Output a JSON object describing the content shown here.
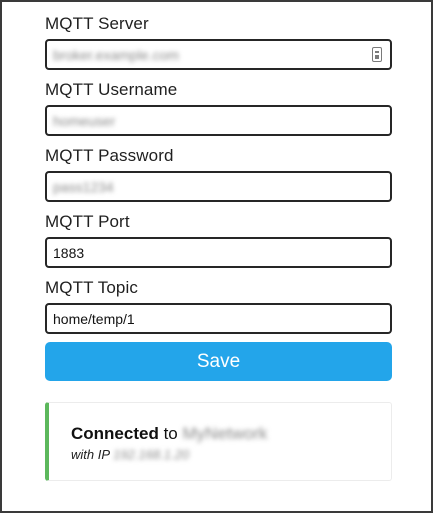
{
  "form": {
    "server": {
      "label": "MQTT Server",
      "value": "broker.example.com"
    },
    "username": {
      "label": "MQTT Username",
      "value": "homeuser"
    },
    "password": {
      "label": "MQTT Password",
      "value": "pass1234"
    },
    "port": {
      "label": "MQTT Port",
      "value": "1883"
    },
    "topic": {
      "label": "MQTT Topic",
      "value": "home/temp/1"
    }
  },
  "save_label": "Save",
  "status": {
    "connected_word": "Connected",
    "to_word": "to",
    "network_name": "MyNetwork",
    "ip_prefix": "with IP",
    "ip_address": "192.168.1.20",
    "accent_color": "#5cb85c"
  },
  "colors": {
    "button": "#23a5ea",
    "status_border": "#5cb85c"
  }
}
